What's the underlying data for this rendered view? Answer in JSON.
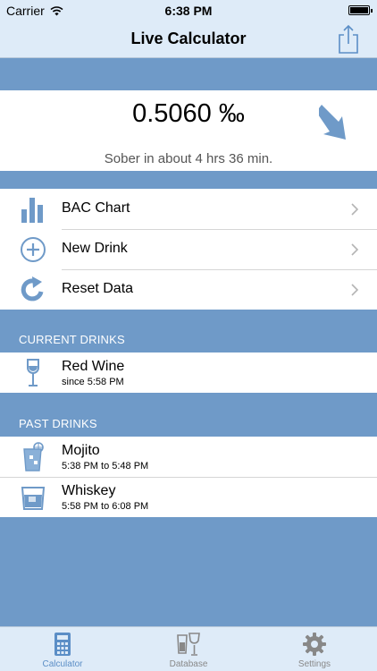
{
  "status_bar": {
    "carrier": "Carrier",
    "time": "6:38 PM"
  },
  "nav": {
    "title": "Live Calculator"
  },
  "bac": {
    "value": "0.5060 ‰",
    "sober_text": "Sober in about 4 hrs 36 min."
  },
  "menu": [
    {
      "label": "BAC Chart",
      "icon": "bar-chart-icon"
    },
    {
      "label": "New Drink",
      "icon": "plus-circle-icon"
    },
    {
      "label": "Reset Data",
      "icon": "reload-icon"
    }
  ],
  "current_drinks": {
    "header": "CURRENT DRINKS",
    "items": [
      {
        "name": "Red Wine",
        "time": "since 5:58 PM",
        "icon": "wine-glass-icon"
      }
    ]
  },
  "past_drinks": {
    "header": "PAST DRINKS",
    "items": [
      {
        "name": "Mojito",
        "time": "5:38 PM to 5:48 PM",
        "icon": "cocktail-icon"
      },
      {
        "name": "Whiskey",
        "time": "5:58 PM to 6:08 PM",
        "icon": "whiskey-glass-icon"
      }
    ]
  },
  "tabs": [
    {
      "label": "Calculator",
      "icon": "calculator-icon",
      "active": true
    },
    {
      "label": "Database",
      "icon": "drinks-database-icon",
      "active": false
    },
    {
      "label": "Settings",
      "icon": "gear-icon",
      "active": false
    }
  ],
  "colors": {
    "accent": "#6f9ac8",
    "bar_background": "#deebf8",
    "tab_active": "#5b8ec6",
    "tab_inactive": "#888888"
  }
}
